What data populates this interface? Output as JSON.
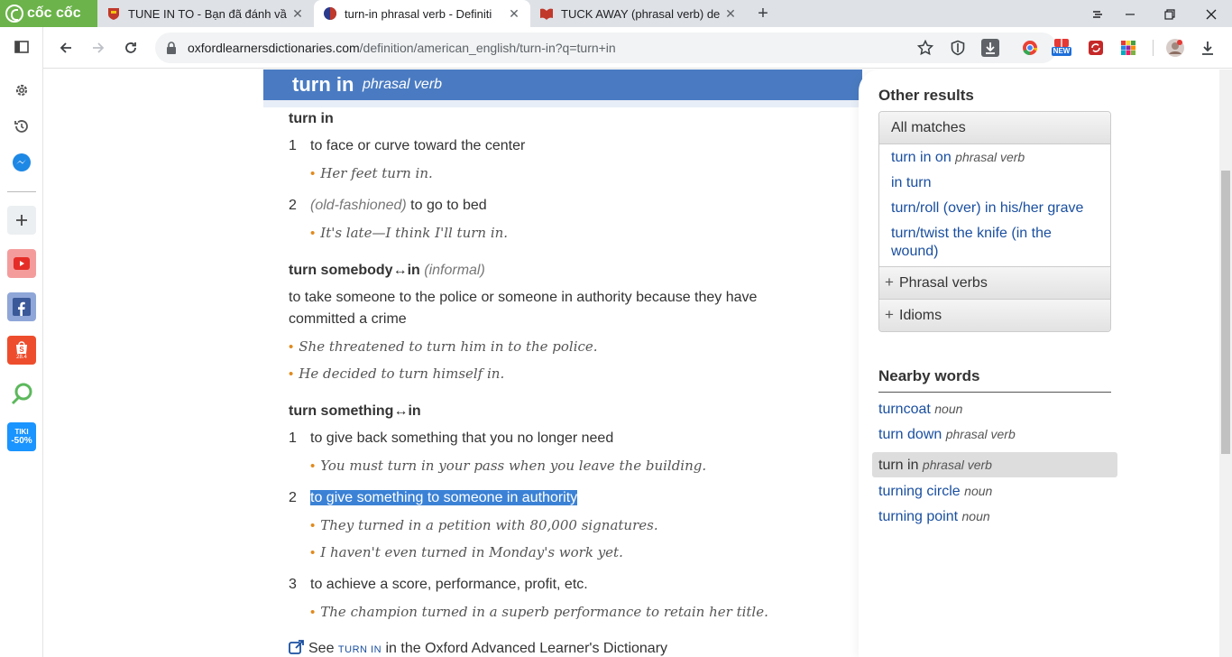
{
  "browser": {
    "brand": "cốc cốc",
    "tabs": [
      {
        "title": "TUNE IN TO - Bạn đã đánh vầ"
      },
      {
        "title": "turn-in phrasal verb - Definiti"
      },
      {
        "title": "TUCK AWAY (phrasal verb) de"
      }
    ],
    "url_host": "oxfordlearnersdictionaries.com",
    "url_path": "/definition/american_english/turn-in?q=turn+in",
    "ext_new_badge": "NEW"
  },
  "sidebar": {
    "tiki_label_top": "TIKI",
    "tiki_label_bottom": "-50%",
    "shopee_badge": "28.4"
  },
  "entry": {
    "headword": "turn in",
    "pos": "phrasal verb",
    "blocks": [
      {
        "title": "turn in",
        "senses": [
          {
            "num": "1",
            "def": "to face or curve toward the center",
            "examples": [
              "Her feet turn in."
            ]
          },
          {
            "num": "2",
            "reg": "(old-fashioned)",
            "def": " to go to bed",
            "examples": [
              "It's late—I think I'll turn in."
            ]
          }
        ]
      },
      {
        "title": "turn somebody↔in",
        "label": "(informal)",
        "def_line1": "to take someone to the police or someone in authority because they have",
        "def_line2": "committed a crime",
        "examples": [
          "She threatened to turn him in to the police.",
          "He decided to turn himself in."
        ]
      },
      {
        "title": "turn something↔in",
        "senses": [
          {
            "num": "1",
            "def": "to give back something that you no longer need",
            "examples": [
              "You must turn in your pass when you leave the building."
            ]
          },
          {
            "num": "2",
            "def": "to give something to someone in authority",
            "examples": [
              "They turned in a petition with 80,000 signatures.",
              "I haven't even turned in Monday's work yet."
            ]
          },
          {
            "num": "3",
            "def": "to achieve a score, performance, profit, etc.",
            "examples": [
              "The champion turned in a superb performance to retain her title."
            ]
          }
        ]
      }
    ],
    "see_pre": "See ",
    "see_link": "turn in",
    "see_post": " in the Oxford Advanced Learner's Dictionary"
  },
  "right": {
    "other_results_title": "Other results",
    "all_matches_tab": "All matches",
    "matches": [
      {
        "text": "turn in on",
        "pos": "phrasal verb"
      },
      {
        "text": "in turn",
        "pos": ""
      },
      {
        "text": "turn/roll (over) in his/her grave",
        "pos": ""
      },
      {
        "text": "turn/twist the knife (in the wound)",
        "pos": ""
      }
    ],
    "phrasal_verbs": "Phrasal verbs",
    "idioms": "Idioms",
    "nearby_title": "Nearby words",
    "nearby": [
      {
        "word": "turncoat",
        "pos": "noun"
      },
      {
        "word": "turn down",
        "pos": "phrasal verb"
      },
      {
        "word": "turn in",
        "pos": "phrasal verb"
      },
      {
        "word": "turning circle",
        "pos": "noun"
      },
      {
        "word": "turning point",
        "pos": "noun"
      }
    ]
  },
  "colors": {
    "header_blue": "#4a7bc2",
    "link_blue": "#1a4fa0",
    "example_bullet": "#e08a1e",
    "highlight": "#3b82d6",
    "coccoc_green": "#6bb34a"
  }
}
